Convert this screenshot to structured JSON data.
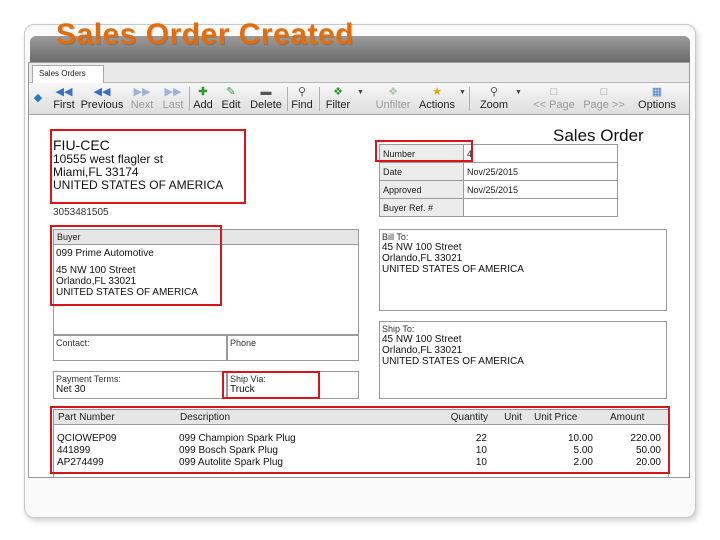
{
  "slide": {
    "title": "Sales Order Created"
  },
  "colors": {
    "title": "#e46c0a",
    "highlight": "#d9141b"
  },
  "window": {
    "tab_label": "Sales Orders"
  },
  "toolbar": [
    {
      "label": "First",
      "icon": "first-icon",
      "enabled": true
    },
    {
      "label": "Previous",
      "icon": "previous-icon",
      "enabled": true
    },
    {
      "label": "Next",
      "icon": "next-icon",
      "enabled": false
    },
    {
      "label": "Last",
      "icon": "last-icon",
      "enabled": false
    },
    {
      "label": "Add",
      "icon": "add-icon",
      "enabled": true
    },
    {
      "label": "Edit",
      "icon": "edit-icon",
      "enabled": true
    },
    {
      "label": "Delete",
      "icon": "delete-icon",
      "enabled": true
    },
    {
      "label": "Find",
      "icon": "find-icon",
      "enabled": true
    },
    {
      "label": "Filter",
      "icon": "filter-icon",
      "enabled": true
    },
    {
      "label": "Unfilter",
      "icon": "unfilter-icon",
      "enabled": false
    },
    {
      "label": "Actions",
      "icon": "actions-icon",
      "enabled": true
    },
    {
      "label": "Zoom",
      "icon": "zoom-icon",
      "enabled": true
    },
    {
      "label": "<< Page",
      "icon": "page-prev-icon",
      "enabled": false
    },
    {
      "label": "Page >>",
      "icon": "page-next-icon",
      "enabled": false
    },
    {
      "label": "Options",
      "icon": "options-icon",
      "enabled": true
    }
  ],
  "document": {
    "heading": "Sales Order",
    "company": {
      "name": "FIU-CEC",
      "street": "10555 west flagler st",
      "city": "Miami,FL 33174",
      "country": "UNITED STATES OF AMERICA",
      "phone": "3053481505"
    },
    "properties": [
      {
        "label": "Number",
        "value": "4"
      },
      {
        "label": "Date",
        "value": "Nov/25/2015"
      },
      {
        "label": "Approved",
        "value": "Nov/25/2015"
      },
      {
        "label": "Buyer Ref. #",
        "value": ""
      }
    ],
    "buyer": {
      "label": "Buyer",
      "name": "099 Prime Automotive",
      "street": "45 NW 100 Street",
      "city": "Orlando,FL 33021",
      "country": "UNITED STATES OF AMERICA"
    },
    "bill_to": {
      "label": "Bill To:",
      "street": "45 NW 100 Street",
      "city": "Orlando,FL 33021",
      "country": "UNITED STATES OF AMERICA"
    },
    "ship_to": {
      "label": "Ship To:",
      "street": "45 NW 100 Street",
      "city": "Orlando,FL 33021",
      "country": "UNITED STATES OF AMERICA"
    },
    "contact_label": "Contact:",
    "phone_label": "Phone",
    "payment_terms": {
      "label": "Payment Terms:",
      "value": "Net 30"
    },
    "ship_via": {
      "label": "Ship Via:",
      "value": "Truck"
    },
    "items_header": {
      "part_number": "Part Number",
      "description": "Description",
      "quantity": "Quantity",
      "unit": "Unit",
      "unit_price": "Unit Price",
      "amount": "Amount"
    },
    "items": [
      {
        "part_number": "QCIOWEP09",
        "description": "099 Champion Spark Plug",
        "quantity": "22",
        "unit": "",
        "unit_price": "10.00",
        "amount": "220.00"
      },
      {
        "part_number": "441899",
        "description": "099 Bosch Spark Plug",
        "quantity": "10",
        "unit": "",
        "unit_price": "5.00",
        "amount": "50.00"
      },
      {
        "part_number": "AP274499",
        "description": "099 Autolite Spark Plug",
        "quantity": "10",
        "unit": "",
        "unit_price": "2.00",
        "amount": "20.00"
      }
    ]
  }
}
